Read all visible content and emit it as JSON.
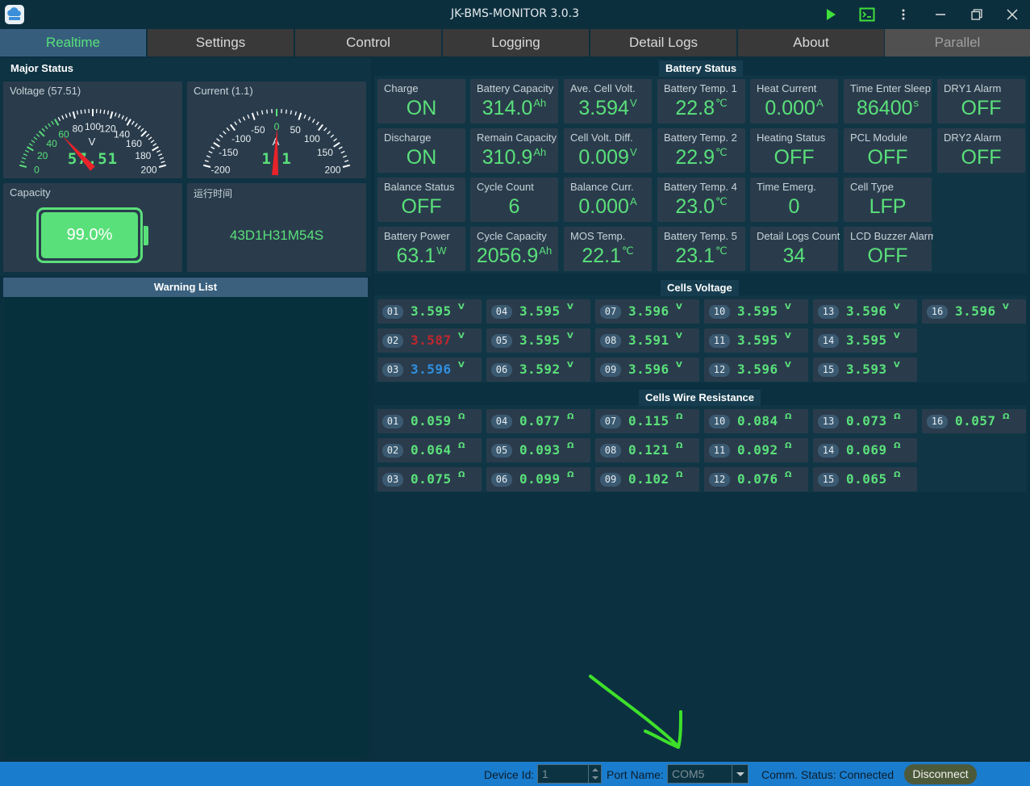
{
  "window": {
    "title": "JK-BMS-MONITOR 3.0.3",
    "icons": [
      "play-icon",
      "terminal-icon",
      "more-icon",
      "minimize-icon",
      "restore-icon",
      "close-icon"
    ]
  },
  "tabs": [
    {
      "label": "Realtime",
      "state": "active"
    },
    {
      "label": "Settings",
      "state": "normal"
    },
    {
      "label": "Control",
      "state": "normal"
    },
    {
      "label": "Logging",
      "state": "normal"
    },
    {
      "label": "Detail Logs",
      "state": "normal"
    },
    {
      "label": "About",
      "state": "normal"
    },
    {
      "label": "Parallel",
      "state": "disabled"
    }
  ],
  "major_status": {
    "title": "Major Status",
    "voltage": {
      "label": "Voltage (57.51)",
      "value": 57.51,
      "value_text": "57.51",
      "unit": "V",
      "min": 0,
      "max": 200,
      "ticks": [
        "0",
        "20",
        "40",
        "60",
        "80",
        "100",
        "120",
        "140",
        "160",
        "180",
        "200"
      ]
    },
    "current": {
      "label": "Current (1.1)",
      "value": 1.1,
      "value_text": "1.1",
      "unit": "A",
      "min": -200,
      "max": 200,
      "ticks": [
        "-200",
        "-150",
        "-100",
        "-50",
        "0",
        "50",
        "100",
        "150",
        "200"
      ]
    },
    "capacity": {
      "label": "Capacity",
      "value_text": "99.0%",
      "percent": 99.0
    },
    "runtime": {
      "label": "运行时间",
      "value": "43D1H31M54S"
    }
  },
  "warning_list": {
    "title": "Warning List",
    "items": []
  },
  "battery_status": {
    "title": "Battery Status",
    "columns": [
      [
        {
          "label": "Charge",
          "value": "ON",
          "unit": ""
        },
        {
          "label": "Discharge",
          "value": "ON",
          "unit": ""
        },
        {
          "label": "Balance Status",
          "value": "OFF",
          "unit": ""
        },
        {
          "label": "Battery Power",
          "value": "63.1",
          "unit": "W"
        }
      ],
      [
        {
          "label": "Battery Capacity",
          "value": "314.0",
          "unit": "Ah"
        },
        {
          "label": "Remain Capacity",
          "value": "310.9",
          "unit": "Ah"
        },
        {
          "label": "Cycle Count",
          "value": "6",
          "unit": ""
        },
        {
          "label": "Cycle Capacity",
          "value": "2056.9",
          "unit": "Ah"
        }
      ],
      [
        {
          "label": "Ave. Cell Volt.",
          "value": "3.594",
          "unit": "V"
        },
        {
          "label": "Cell Volt. Diff.",
          "value": "0.009",
          "unit": "V"
        },
        {
          "label": "Balance Curr.",
          "value": "0.000",
          "unit": "A"
        },
        {
          "label": "MOS Temp.",
          "value": "22.1",
          "unit": "℃"
        }
      ],
      [
        {
          "label": "Battery Temp. 1",
          "value": "22.8",
          "unit": "℃"
        },
        {
          "label": "Battery Temp. 2",
          "value": "22.9",
          "unit": "℃"
        },
        {
          "label": "Battery Temp. 4",
          "value": "23.0",
          "unit": "℃"
        },
        {
          "label": "Battery Temp. 5",
          "value": "23.1",
          "unit": "℃"
        }
      ],
      [
        {
          "label": "Heat Current",
          "value": "0.000",
          "unit": "A"
        },
        {
          "label": "Heating Status",
          "value": "OFF",
          "unit": ""
        },
        {
          "label": "Time Emerg.",
          "value": "0",
          "unit": ""
        },
        {
          "label": "Detail Logs Count",
          "value": "34",
          "unit": ""
        }
      ],
      [
        {
          "label": "Time Enter Sleep",
          "value": "86400",
          "unit": "s"
        },
        {
          "label": "PCL Module",
          "value": "OFF",
          "unit": ""
        },
        {
          "label": "Cell Type",
          "value": "LFP",
          "unit": ""
        },
        {
          "label": "LCD Buzzer Alarm",
          "value": "OFF",
          "unit": ""
        }
      ],
      [
        {
          "label": "DRY1 Alarm",
          "value": "OFF",
          "unit": ""
        },
        {
          "label": "DRY2 Alarm",
          "value": "OFF",
          "unit": ""
        }
      ]
    ]
  },
  "cells_voltage": {
    "title": "Cells Voltage",
    "unit": "V",
    "colors": {
      "normal": "#5ae07a",
      "min": "#c0272d",
      "max": "#2f8fe0"
    },
    "cells": [
      {
        "id": "01",
        "value": "3.595",
        "state": "normal"
      },
      {
        "id": "02",
        "value": "3.587",
        "state": "min"
      },
      {
        "id": "03",
        "value": "3.596",
        "state": "max"
      },
      {
        "id": "04",
        "value": "3.595",
        "state": "normal"
      },
      {
        "id": "05",
        "value": "3.595",
        "state": "normal"
      },
      {
        "id": "06",
        "value": "3.592",
        "state": "normal"
      },
      {
        "id": "07",
        "value": "3.596",
        "state": "normal"
      },
      {
        "id": "08",
        "value": "3.591",
        "state": "normal"
      },
      {
        "id": "09",
        "value": "3.596",
        "state": "normal"
      },
      {
        "id": "10",
        "value": "3.595",
        "state": "normal"
      },
      {
        "id": "11",
        "value": "3.595",
        "state": "normal"
      },
      {
        "id": "12",
        "value": "3.596",
        "state": "normal"
      },
      {
        "id": "13",
        "value": "3.596",
        "state": "normal"
      },
      {
        "id": "14",
        "value": "3.595",
        "state": "normal"
      },
      {
        "id": "15",
        "value": "3.593",
        "state": "normal"
      },
      {
        "id": "16",
        "value": "3.596",
        "state": "normal"
      }
    ]
  },
  "cells_resistance": {
    "title": "Cells Wire Resistance",
    "unit": "Ω",
    "cells": [
      {
        "id": "01",
        "value": "0.059"
      },
      {
        "id": "02",
        "value": "0.064"
      },
      {
        "id": "03",
        "value": "0.075"
      },
      {
        "id": "04",
        "value": "0.077"
      },
      {
        "id": "05",
        "value": "0.093"
      },
      {
        "id": "06",
        "value": "0.099"
      },
      {
        "id": "07",
        "value": "0.115"
      },
      {
        "id": "08",
        "value": "0.121"
      },
      {
        "id": "09",
        "value": "0.102"
      },
      {
        "id": "10",
        "value": "0.084"
      },
      {
        "id": "11",
        "value": "0.092"
      },
      {
        "id": "12",
        "value": "0.076"
      },
      {
        "id": "13",
        "value": "0.073"
      },
      {
        "id": "14",
        "value": "0.069"
      },
      {
        "id": "15",
        "value": "0.065"
      },
      {
        "id": "16",
        "value": "0.057"
      }
    ]
  },
  "statusbar": {
    "device_id_label": "Device Id:",
    "device_id_value": "1",
    "port_name_label": "Port Name:",
    "port_name_value": "COM5",
    "comm_status": "Comm. Status: Connected",
    "disconnect_label": "Disconnect"
  },
  "colors": {
    "accent_green": "#5ae07a",
    "active_tab": "#365e7c",
    "statusbar_blue": "#1a7ccd",
    "needle_red": "#e8232a",
    "annotation_arrow": "#3ee02a"
  }
}
